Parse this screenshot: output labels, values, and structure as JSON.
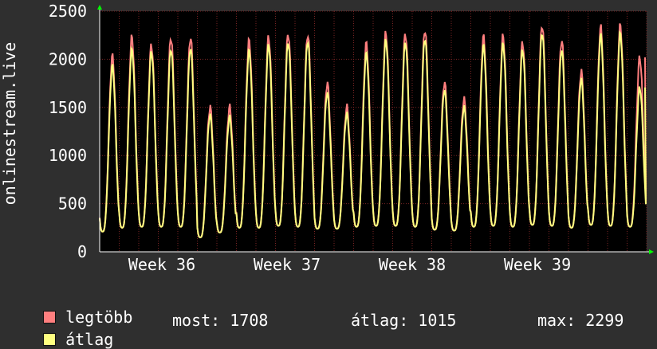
{
  "chart_data": {
    "type": "line",
    "title": "",
    "ylabel": "onlinestream.live",
    "ylim": [
      0,
      2500
    ],
    "yticks": [
      0,
      500,
      1000,
      1500,
      2000,
      2500
    ],
    "xticks": [
      "Week 36",
      "Week 37",
      "Week 38",
      "Week 39"
    ],
    "grid": true,
    "colors": {
      "background": "#2f2f2f",
      "plot": "#000000",
      "grid": "#7a2424",
      "max": "#ff7f7f",
      "avg": "#ffff80",
      "axis": "#ffffff",
      "arrow": "#00ff00"
    },
    "series": [
      {
        "name": "legtöbb",
        "daily_peaks": [
          2030,
          2230,
          2150,
          2230,
          2230,
          1500,
          1500,
          2190,
          2230,
          2270,
          2260,
          1750,
          1500,
          2160,
          2270,
          2270,
          2310,
          1760,
          1580,
          2230,
          2240,
          2180,
          2360,
          2200,
          1870,
          2330,
          2350,
          2020
        ],
        "daily_troughs": [
          210,
          250,
          260,
          260,
          260,
          150,
          200,
          250,
          250,
          270,
          260,
          240,
          240,
          260,
          270,
          270,
          260,
          230,
          220,
          260,
          270,
          260,
          280,
          270,
          250,
          280,
          270,
          260
        ]
      },
      {
        "name": "átlag",
        "daily_peaks": [
          1930,
          2100,
          2080,
          2110,
          2120,
          1420,
          1400,
          2090,
          2150,
          2180,
          2190,
          1650,
          1430,
          2060,
          2200,
          2180,
          2220,
          1680,
          1500,
          2140,
          2160,
          2100,
          2280,
          2100,
          1790,
          2250,
          2270,
          1708
        ],
        "daily_troughs": [
          210,
          250,
          260,
          260,
          260,
          150,
          200,
          250,
          250,
          270,
          260,
          240,
          240,
          260,
          270,
          270,
          260,
          230,
          220,
          260,
          270,
          260,
          280,
          270,
          250,
          280,
          270,
          260
        ]
      }
    ],
    "legend": [
      {
        "label": "legtöbb",
        "color": "#ff7f7f"
      },
      {
        "label": "átlag",
        "color": "#ffff80"
      }
    ],
    "stats": {
      "now_label": "most:",
      "now_value": "1708",
      "avg_label": "átlag:",
      "avg_value": "1015",
      "max_label": "max:",
      "max_value": "2299"
    }
  }
}
